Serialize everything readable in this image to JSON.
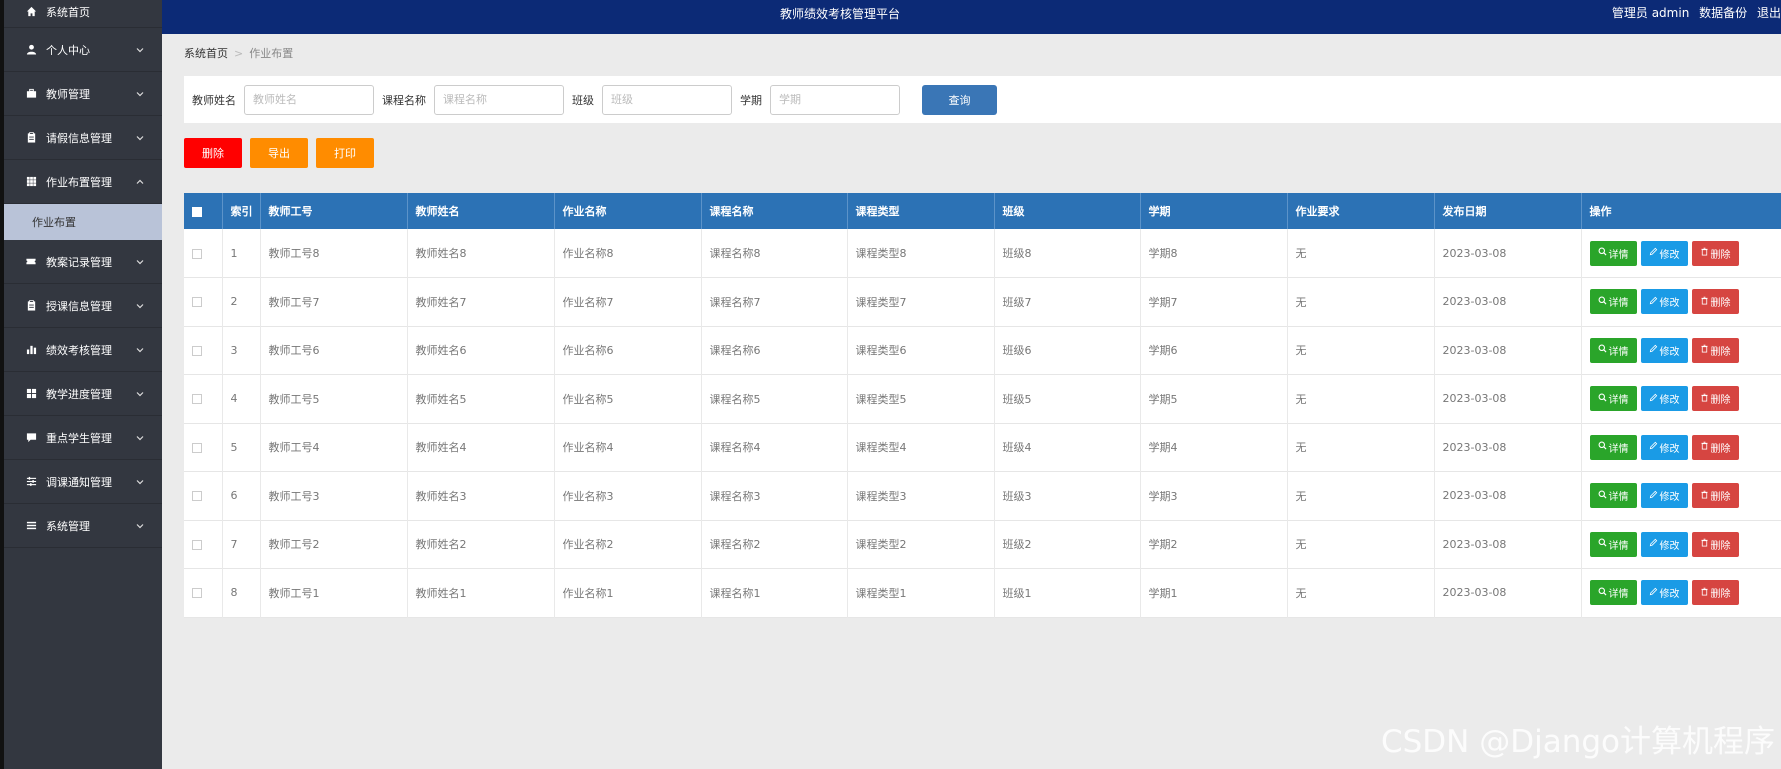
{
  "header": {
    "title": "教师绩效考核管理平台",
    "admin": "管理员 admin",
    "backup": "数据备份",
    "logout": "退出"
  },
  "sidebar": {
    "items": [
      {
        "label": "系统首页",
        "icon": "home-icon",
        "chevron": false
      },
      {
        "label": "个人中心",
        "icon": "user-icon",
        "chevron": "down"
      },
      {
        "label": "教师管理",
        "icon": "briefcase-icon",
        "chevron": "down"
      },
      {
        "label": "请假信息管理",
        "icon": "clipboard-icon",
        "chevron": "down"
      },
      {
        "label": "作业布置管理",
        "icon": "grid-icon",
        "chevron": "up"
      },
      {
        "label": "教案记录管理",
        "icon": "ticket-icon",
        "chevron": "down"
      },
      {
        "label": "授课信息管理",
        "icon": "clipboard-icon",
        "chevron": "down"
      },
      {
        "label": "绩效考核管理",
        "icon": "bar-chart-icon",
        "chevron": "down"
      },
      {
        "label": "教学进度管理",
        "icon": "apps-icon",
        "chevron": "down"
      },
      {
        "label": "重点学生管理",
        "icon": "comment-icon",
        "chevron": "down"
      },
      {
        "label": "调课通知管理",
        "icon": "sliders-icon",
        "chevron": "down"
      },
      {
        "label": "系统管理",
        "icon": "menu-icon",
        "chevron": "down"
      }
    ],
    "active_sub": "作业布置"
  },
  "breadcrumb": {
    "home": "系统首页",
    "sep": ">",
    "current": "作业布置"
  },
  "search": {
    "teacher_label": "教师姓名",
    "teacher_placeholder": "教师姓名",
    "course_label": "课程名称",
    "course_placeholder": "课程名称",
    "class_label": "班级",
    "class_placeholder": "班级",
    "term_label": "学期",
    "term_placeholder": "学期",
    "query_label": "查询"
  },
  "actions": {
    "delete": "删除",
    "export": "导出",
    "print": "打印"
  },
  "table": {
    "columns": [
      "索引",
      "教师工号",
      "教师姓名",
      "作业名称",
      "课程名称",
      "课程类型",
      "班级",
      "学期",
      "作业要求",
      "发布日期",
      "操作"
    ],
    "rows": [
      [
        "1",
        "教师工号8",
        "教师姓名8",
        "作业名称8",
        "课程名称8",
        "课程类型8",
        "班级8",
        "学期8",
        "无",
        "2023-03-08"
      ],
      [
        "2",
        "教师工号7",
        "教师姓名7",
        "作业名称7",
        "课程名称7",
        "课程类型7",
        "班级7",
        "学期7",
        "无",
        "2023-03-08"
      ],
      [
        "3",
        "教师工号6",
        "教师姓名6",
        "作业名称6",
        "课程名称6",
        "课程类型6",
        "班级6",
        "学期6",
        "无",
        "2023-03-08"
      ],
      [
        "4",
        "教师工号5",
        "教师姓名5",
        "作业名称5",
        "课程名称5",
        "课程类型5",
        "班级5",
        "学期5",
        "无",
        "2023-03-08"
      ],
      [
        "5",
        "教师工号4",
        "教师姓名4",
        "作业名称4",
        "课程名称4",
        "课程类型4",
        "班级4",
        "学期4",
        "无",
        "2023-03-08"
      ],
      [
        "6",
        "教师工号3",
        "教师姓名3",
        "作业名称3",
        "课程名称3",
        "课程类型3",
        "班级3",
        "学期3",
        "无",
        "2023-03-08"
      ],
      [
        "7",
        "教师工号2",
        "教师姓名2",
        "作业名称2",
        "课程名称2",
        "课程类型2",
        "班级2",
        "学期2",
        "无",
        "2023-03-08"
      ],
      [
        "8",
        "教师工号1",
        "教师姓名1",
        "作业名称1",
        "课程名称1",
        "课程类型1",
        "班级1",
        "学期1",
        "无",
        "2023-03-08"
      ]
    ],
    "row_actions": {
      "detail": "详情",
      "edit": "修改",
      "delete": "删除"
    }
  },
  "watermark": "CSDN @Django计算机程序",
  "colors": {
    "header_bg": "#0c2a76",
    "sidebar_bg": "#333740",
    "table_head": "#2c72b5",
    "query_btn": "#3a76b6",
    "delete_red": "#ff0000",
    "orange": "#ff8c00",
    "detail_green": "#2aa52a",
    "edit_blue": "#1a9be6",
    "row_delete_red": "#d64541"
  }
}
